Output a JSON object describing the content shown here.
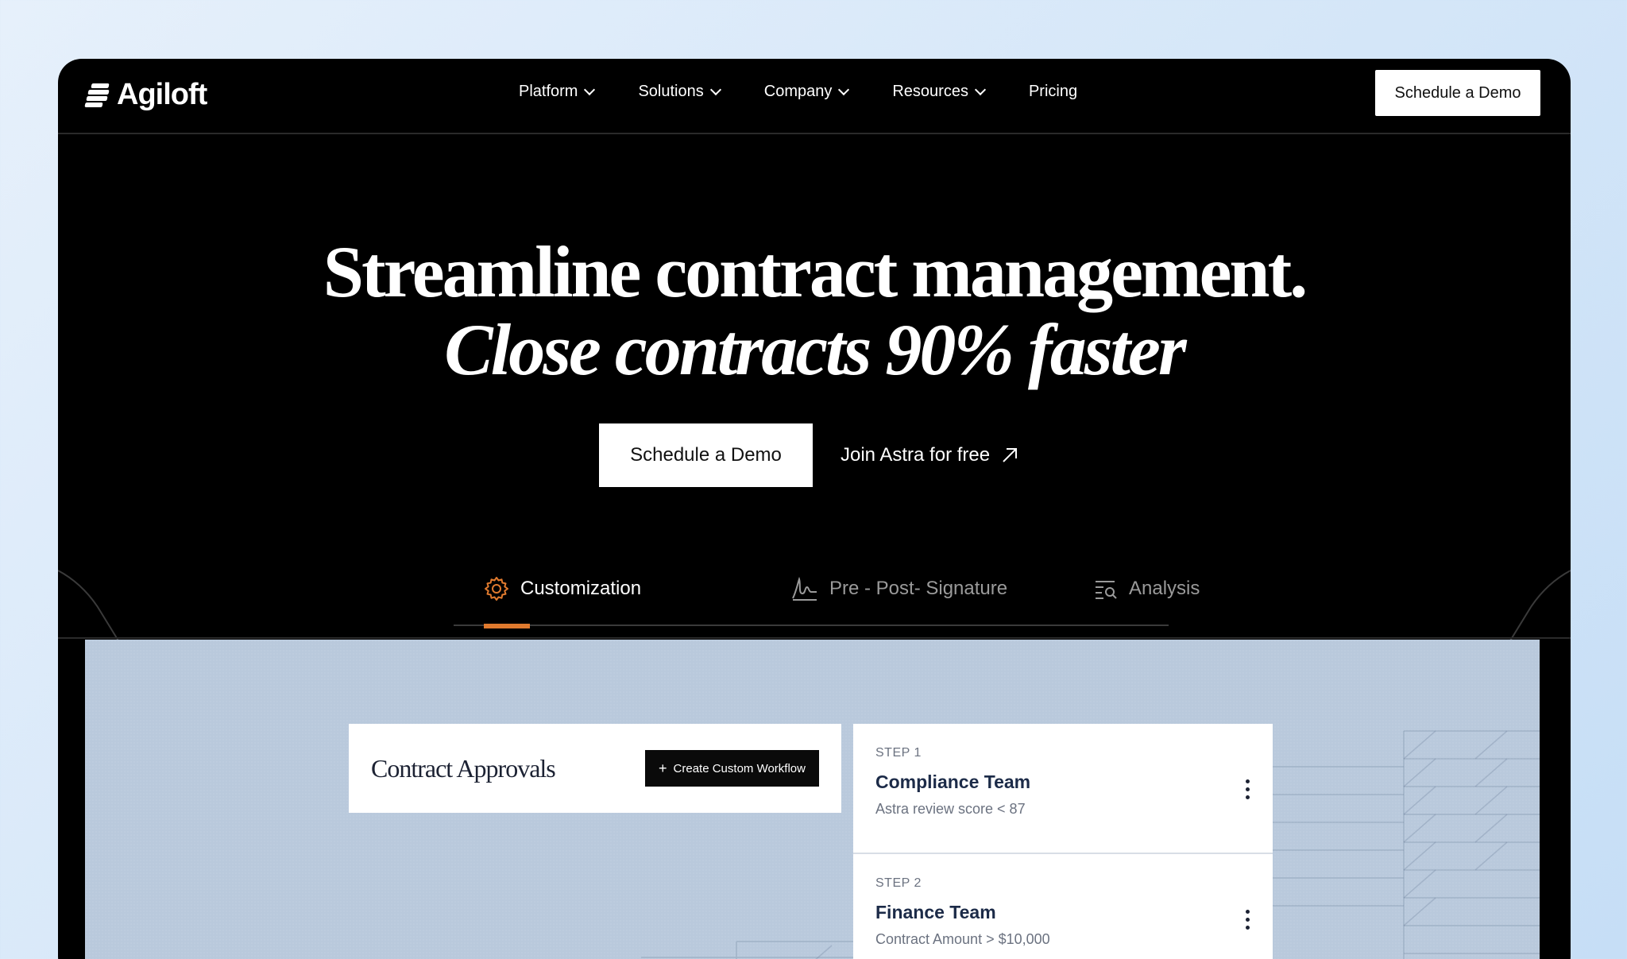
{
  "brand": {
    "name": "Agiloft"
  },
  "nav": {
    "items": [
      {
        "label": "Platform",
        "has_dropdown": true
      },
      {
        "label": "Solutions",
        "has_dropdown": true
      },
      {
        "label": "Company",
        "has_dropdown": true
      },
      {
        "label": "Resources",
        "has_dropdown": true
      },
      {
        "label": "Pricing",
        "has_dropdown": false
      }
    ],
    "cta_label": "Schedule a Demo"
  },
  "hero": {
    "title": "Streamline contract management.",
    "subtitle": "Close contracts 90% faster",
    "primary_cta": "Schedule a Demo",
    "secondary_cta": "Join Astra for free"
  },
  "tabs": [
    {
      "label": "Customization",
      "icon": "gear-icon",
      "active": true
    },
    {
      "label": "Pre - Post- Signature",
      "icon": "signature-icon",
      "active": false
    },
    {
      "label": "Analysis",
      "icon": "list-search-icon",
      "active": false
    }
  ],
  "preview": {
    "card_title": "Contract Approvals",
    "workflow_button": "Create Custom Workflow",
    "steps": [
      {
        "label": "STEP 1",
        "name": "Compliance Team",
        "description": "Astra review score < 87"
      },
      {
        "label": "STEP 2",
        "name": "Finance Team",
        "description": "Contract Amount > $10,000"
      }
    ]
  },
  "colors": {
    "accent": "#e07a2e",
    "background": "#000000",
    "preview_bg": "#b9c9dc"
  }
}
